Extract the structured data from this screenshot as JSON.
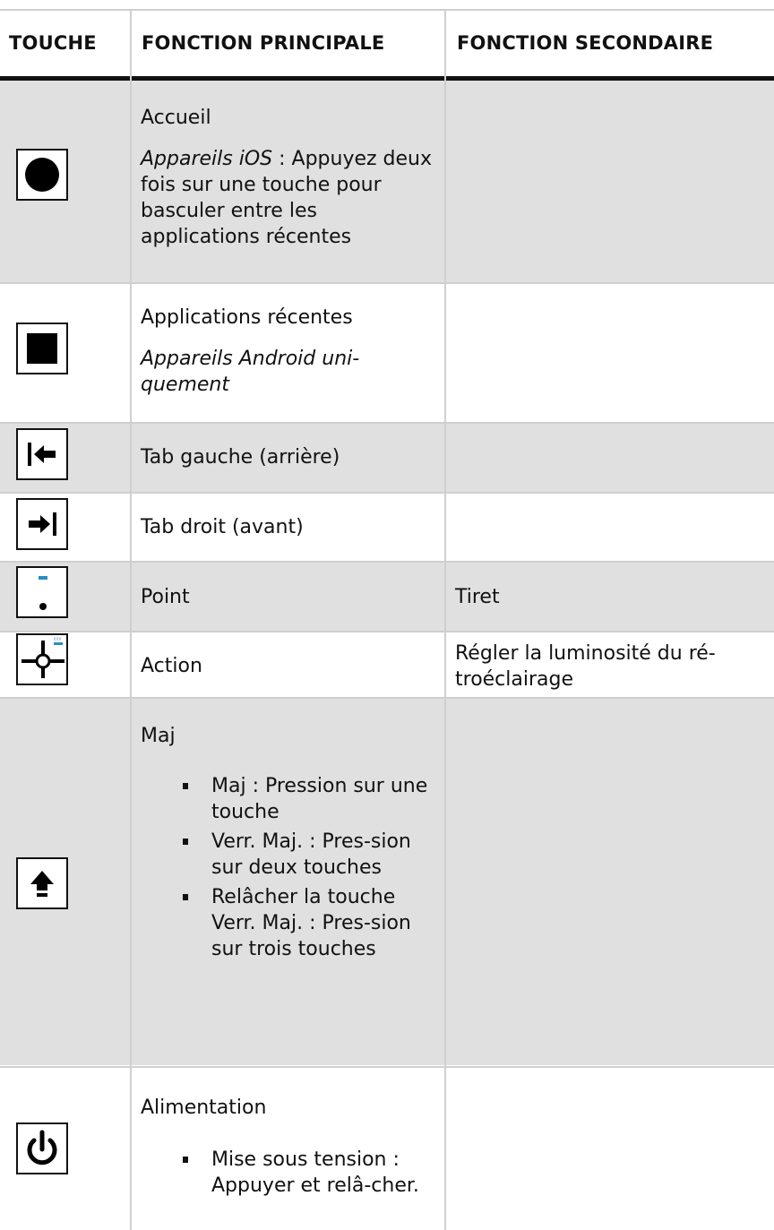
{
  "headers": {
    "key": "TOUCHE",
    "primary": "FONCTION PRINCIPALE",
    "secondary": "FONCTION SECONDAIRE"
  },
  "rows": [
    {
      "icon": "home-circle-icon",
      "primary": "Accueil",
      "note_italic": "Appareils iOS",
      "note_rest": " : Appuyez deux fois sur une touche pour basculer entre les applications récentes",
      "secondary": ""
    },
    {
      "icon": "recent-apps-square-icon",
      "primary": "Applications récentes",
      "note_italic": "Appareils Android uni-quement",
      "secondary": ""
    },
    {
      "icon": "tab-left-icon",
      "primary": "Tab gauche (arrière)",
      "secondary": ""
    },
    {
      "icon": "tab-right-icon",
      "primary": "Tab droit (avant)",
      "secondary": ""
    },
    {
      "icon": "dot-dash-icon",
      "primary": "Point",
      "secondary": "Tiret"
    },
    {
      "icon": "action-crosshair-icon",
      "primary": "Action",
      "secondary": "Régler la luminosité du ré-troéclairage"
    },
    {
      "icon": "shift-arrow-icon",
      "primary": "Maj",
      "bullets": [
        "Maj : Pression sur une touche",
        "Verr. Maj. : Pres-sion sur deux touches",
        "Relâcher la touche Verr. Maj. : Pres-sion sur trois touches"
      ],
      "secondary": ""
    },
    {
      "icon": "power-icon",
      "primary": "Alimentation",
      "bullets": [
        "Mise sous tension : Appuyer et relâ-cher."
      ],
      "secondary": ""
    }
  ],
  "colors": {
    "shaded_row": "#e0e0e0",
    "grid": "#cfcfcf",
    "header_rule": "#111111",
    "accent_blue": "#2a8fc0"
  }
}
